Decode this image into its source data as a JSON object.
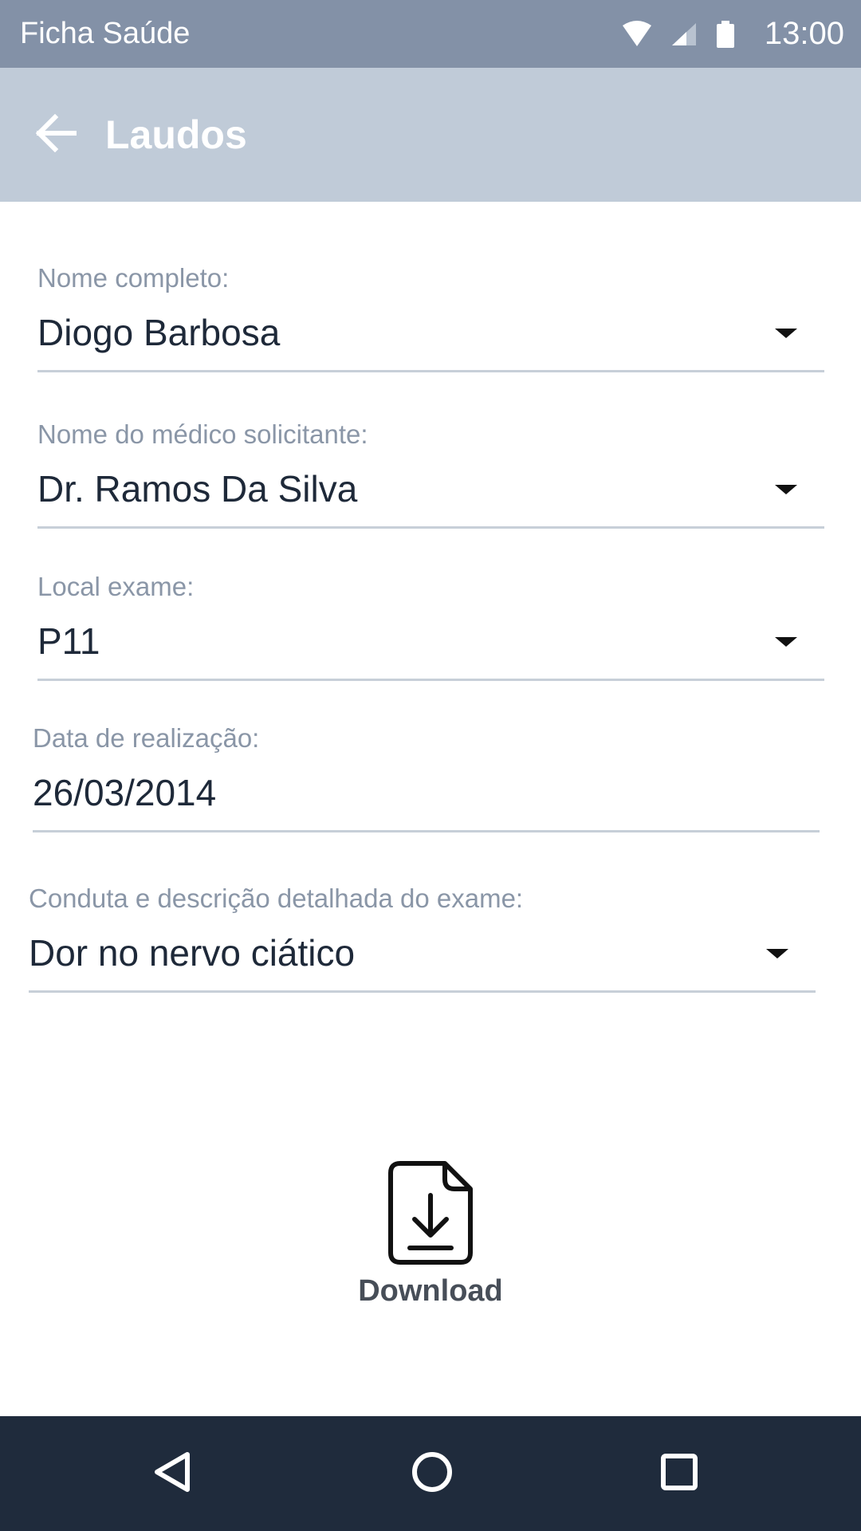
{
  "status_bar": {
    "app_name": "Ficha Saúde",
    "time": "13:00",
    "icons": [
      "wifi-icon",
      "signal-icon",
      "battery-icon"
    ]
  },
  "app_bar": {
    "title": "Laudos",
    "back_icon": "arrow-left-icon"
  },
  "form": {
    "nome_completo": {
      "label": "Nome completo:",
      "value": "Diogo Barbosa"
    },
    "medico": {
      "label": "Nome do médico solicitante:",
      "value": "Dr. Ramos Da Silva"
    },
    "local": {
      "label": "Local exame:",
      "value": "P11"
    },
    "data": {
      "label": "Data de realização:",
      "value": "26/03/2014"
    },
    "conduta": {
      "label": "Conduta e descrição detalhada do exame:",
      "value": "Dor no nervo ciático"
    }
  },
  "download": {
    "label": "Download",
    "icon": "file-download-icon"
  },
  "nav_bar": {
    "icons": [
      "back-triangle-icon",
      "home-circle-icon",
      "recents-square-icon"
    ]
  },
  "colors": {
    "status_bar": "#8391a7",
    "app_bar": "#c0cbd8",
    "nav_bar": "#1f2b3c",
    "label": "#8a96a7",
    "value": "#1e2939"
  }
}
